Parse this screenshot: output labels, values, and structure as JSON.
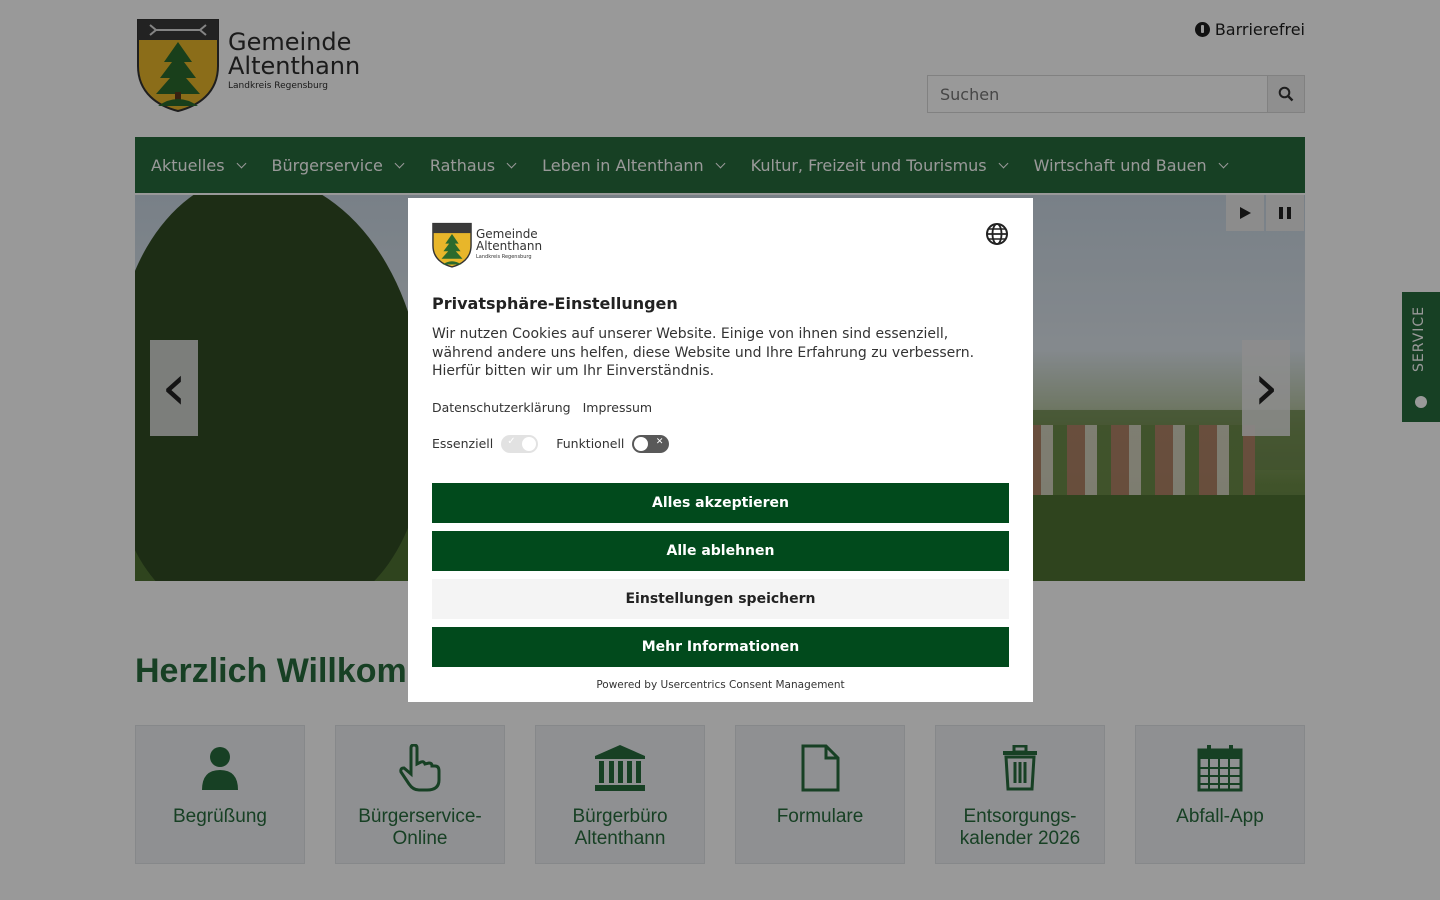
{
  "header": {
    "logo": {
      "line1": "Gemeinde",
      "line2": "Altenthann",
      "subtitle": "Landkreis Regensburg"
    },
    "accessibility_label": "Barrierefrei",
    "search": {
      "placeholder": "Suchen"
    }
  },
  "nav": {
    "items": [
      {
        "label": "Aktuelles"
      },
      {
        "label": "Bürgerservice"
      },
      {
        "label": "Rathaus"
      },
      {
        "label": "Leben in Altenthann"
      },
      {
        "label": "Kultur, Freizeit und Tourismus"
      },
      {
        "label": "Wirtschaft und Bauen"
      }
    ]
  },
  "slider": {
    "prev_symbol": "‹",
    "next_symbol": "›"
  },
  "service_tab": {
    "label": "SERVICE"
  },
  "main": {
    "welcome_heading": "Herzlich Willkommen",
    "tiles": [
      {
        "label": "Begrüßung",
        "icon": "user-icon"
      },
      {
        "label": "Bürgerservice-Online",
        "icon": "pointer-hand-icon"
      },
      {
        "label": "Bürgerbüro Altenthann",
        "icon": "institution-icon"
      },
      {
        "label": "Formulare",
        "icon": "document-icon"
      },
      {
        "label": "Entsorgungs-kalender 2026",
        "icon": "trash-icon"
      },
      {
        "label": "Abfall-App",
        "icon": "calendar-icon"
      }
    ]
  },
  "consent": {
    "logo": {
      "line1": "Gemeinde",
      "line2": "Altenthann",
      "subtitle": "Landkreis Regensburg"
    },
    "title": "Privatsphäre-Einstellungen",
    "text": "Wir nutzen Cookies auf unserer Website. Einige von ihnen sind essenziell, während andere uns helfen, diese Website und Ihre Erfahrung zu verbessern. Hierfür bitten wir um Ihr Einverständnis.",
    "links": {
      "privacy": "Datenschutzerklärung",
      "imprint": "Impressum"
    },
    "toggles": [
      {
        "label": "Essenziell",
        "state": "on-locked"
      },
      {
        "label": "Funktionell",
        "state": "off"
      }
    ],
    "buttons": {
      "accept_all": "Alles akzeptieren",
      "deny_all": "Alle ablehnen",
      "save": "Einstellungen speichern",
      "more": "Mehr Informationen"
    },
    "powered_by": "Powered by Usercentrics Consent Management"
  },
  "colors": {
    "brand_green": "#276b3c",
    "dialog_green": "#014a1c"
  }
}
